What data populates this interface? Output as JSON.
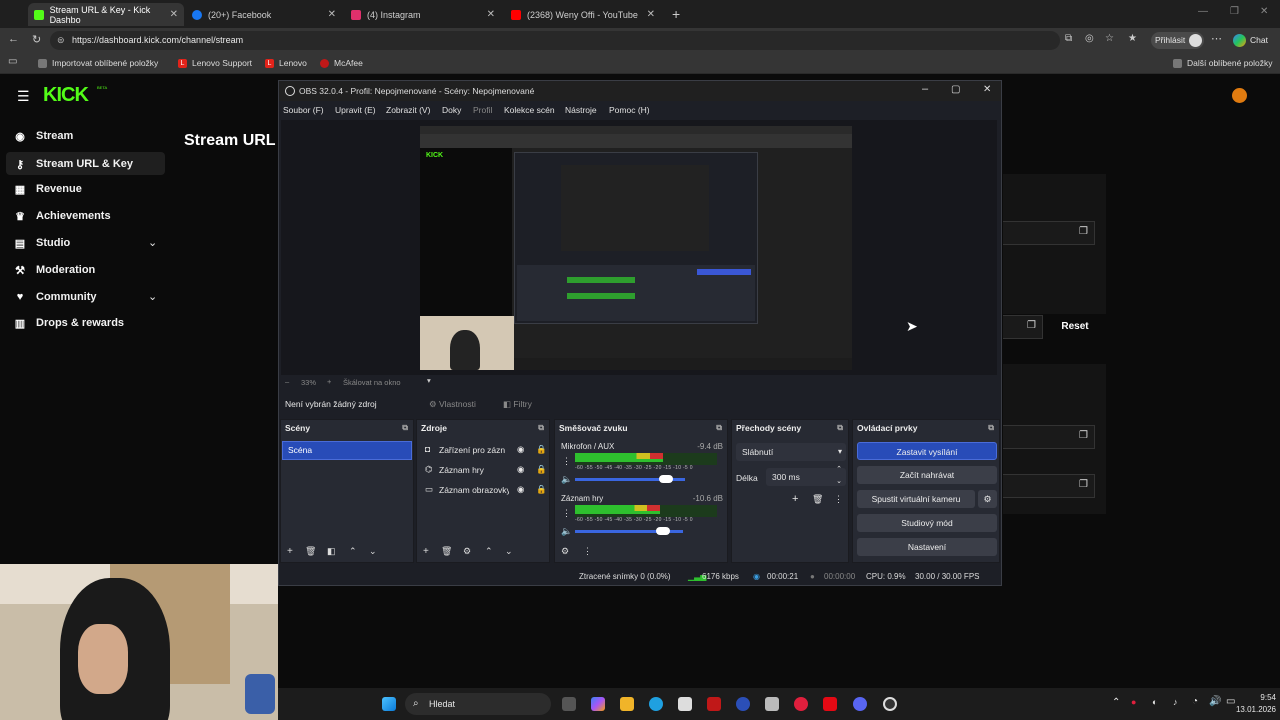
{
  "browser": {
    "tabs": [
      {
        "label": "Stream URL & Key - Kick Dashbo",
        "color": "#53fc18"
      },
      {
        "label": "(20+) Facebook",
        "color": "#1877f2"
      },
      {
        "label": "(4) Instagram",
        "color": "#e1306c"
      },
      {
        "label": "(2368) Weny Offi - YouTube",
        "color": "#ff0000"
      }
    ],
    "url": "https://dashboard.kick.com/channel/stream",
    "signin_label": "Přihlásit",
    "chat_label": "Chat",
    "bookmarks": [
      "Importovat oblíbené položky",
      "Lenovo Support",
      "Lenovo",
      "McAfee"
    ],
    "other_bookmarks": "Další oblíbené položky"
  },
  "kick": {
    "logo": "KICK",
    "logo_badge": "BETA",
    "page_title": "Stream URL",
    "nav": [
      {
        "label": "Stream",
        "icon": "broadcast-icon"
      },
      {
        "label": "Stream URL & Key",
        "icon": "key-icon"
      },
      {
        "label": "Revenue",
        "icon": "revenue-icon"
      },
      {
        "label": "Achievements",
        "icon": "trophy-icon"
      },
      {
        "label": "Studio",
        "icon": "studio-icon"
      },
      {
        "label": "Moderation",
        "icon": "shield-icon"
      },
      {
        "label": "Community",
        "icon": "community-icon"
      },
      {
        "label": "Drops & rewards",
        "icon": "gift-icon"
      }
    ],
    "reset_label": "Reset"
  },
  "obs": {
    "title": "OBS 32.0.4 - Profil: Nepojmenované - Scény: Nepojmenované",
    "menu": [
      "Soubor (F)",
      "Upravit (E)",
      "Zobrazit (V)",
      "Doky",
      "Profil",
      "Kolekce scén",
      "Nástroje",
      "Pomoc (H)"
    ],
    "zoom": "33%",
    "scale_label": "Škálovat na okno",
    "no_source": "Není vybrán žádný zdroj",
    "properties": "Vlastnosti",
    "filters": "Filtry",
    "scenes_title": "Scény",
    "scenes": [
      "Scéna"
    ],
    "sources_title": "Zdroje",
    "sources": [
      "Zařízení pro záznam",
      "Záznam hry",
      "Záznam obrazovky"
    ],
    "mixer_title": "Směšovač zvuku",
    "mixer": [
      {
        "name": "Mikrofon / AUX",
        "db": "-9.4 dB",
        "level": 0.62
      },
      {
        "name": "Záznam hry",
        "db": "-10.6 dB",
        "level": 0.6
      }
    ],
    "meter_ticks": "-60 -55 -50 -45 -40 -35 -30 -25 -20 -15 -10 -5 0",
    "transitions_title": "Přechody scény",
    "transition": "Slábnutí",
    "duration_label": "Délka",
    "duration": "300 ms",
    "controls_title": "Ovládací prvky",
    "controls": [
      "Zastavit vysílání",
      "Začít nahrávat",
      "Spustit virtuální kameru",
      "Studiový mód",
      "Nastavení"
    ],
    "status": {
      "dropped": "Ztracené snímky 0 (0.0%)",
      "bitrate": "6176 kbps",
      "stream_time": "00:00:21",
      "rec_time": "00:00:00",
      "cpu": "CPU: 0.9%",
      "fps": "30.00 / 30.00 FPS"
    }
  },
  "taskbar": {
    "search": "Hledat",
    "time": "9:54",
    "date": "13.01.2026"
  }
}
